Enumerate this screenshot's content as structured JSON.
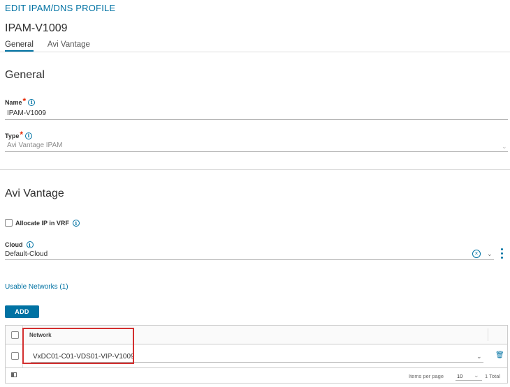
{
  "header": {
    "title": "EDIT IPAM/DNS PROFILE",
    "profile_name": "IPAM-V1009"
  },
  "tabs": [
    {
      "label": "General",
      "active": true
    },
    {
      "label": "Avi Vantage",
      "active": false
    }
  ],
  "general": {
    "title": "General",
    "name_label": "Name",
    "name_value": "IPAM-V1009",
    "type_label": "Type",
    "type_value": "Avi Vantage IPAM"
  },
  "vantage": {
    "title": "Avi Vantage",
    "allocate_label": "Allocate IP in VRF",
    "cloud_label": "Cloud",
    "cloud_value": "Default-Cloud",
    "usable_networks_label": "Usable Networks (1)",
    "add_label": "ADD"
  },
  "grid": {
    "column_network": "Network",
    "rows": [
      {
        "network": "VxDC01-C01-VDS01-VIP-V1009"
      }
    ],
    "items_per_page_label": "Items per page",
    "items_per_page_value": "10",
    "total_label": "1 Total"
  },
  "icons": {
    "info": "info-icon",
    "chevron": "chevron-down-icon",
    "clear": "clear-circle-icon",
    "more": "vertical-ellipsis-icon",
    "delete": "trash-icon",
    "columns": "column-toggle-icon"
  },
  "colors": {
    "accent": "#0072a3",
    "required": "#e62700",
    "highlight": "#d32f2f"
  }
}
